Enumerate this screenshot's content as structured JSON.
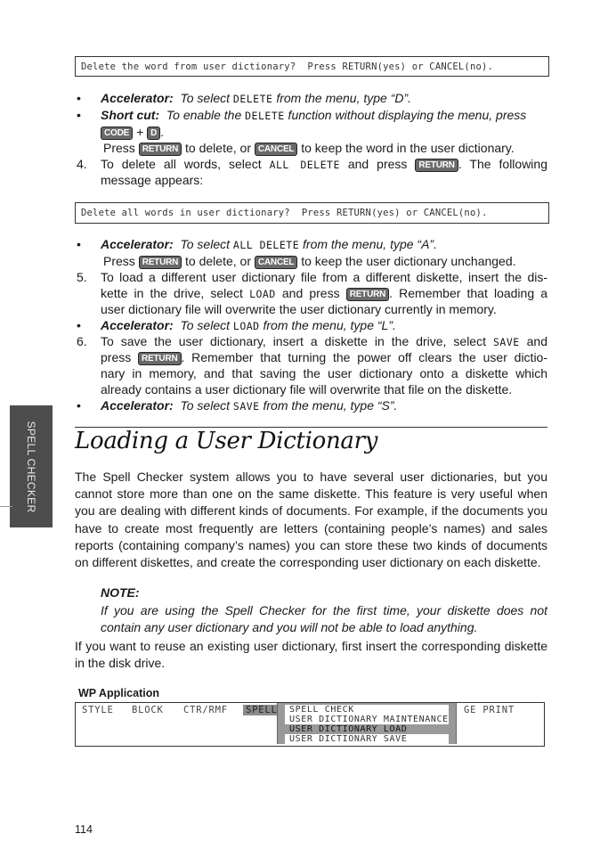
{
  "screen_messages": {
    "delete_word": "Delete the word from user dictionary?  Press RETURN(yes) or CANCEL(no).",
    "delete_all": "Delete all words in user dictionary?  Press RETURN(yes) or CANCEL(no)."
  },
  "keys": {
    "code": "CODE",
    "d": "D",
    "return": "RETURN",
    "cancel": "CANCEL"
  },
  "instructions": {
    "acc_label": "Accelerator:",
    "short_label": "Short cut:",
    "bullet_char": "•",
    "acc_delete": {
      "pre": "To select ",
      "cmd": "DELETE",
      "post": " from the menu, type “D”."
    },
    "shortcut_delete": {
      "pre": "To enable the ",
      "cmd": "DELETE",
      "post": " function without displaying the menu, press"
    },
    "shortcut_plus": " + ",
    "shortcut_end": ".",
    "press_delete_word": {
      "pre": "Press ",
      "mid": " to delete, or ",
      "post": " to keep the word in the user dictionary."
    },
    "step4": {
      "num": "4.",
      "pre": "To delete all words, select ",
      "cmd": "ALL DELETE",
      "mid": " and press ",
      "post": ". The following",
      "line2": "message appears:"
    },
    "acc_all_delete": {
      "pre": "To select ",
      "cmd": "ALL DELETE",
      "post": " from the menu, type “A”."
    },
    "press_delete_all": {
      "pre": "Press ",
      "mid": " to delete, or ",
      "post": " to keep the user dictionary unchanged."
    },
    "step5": {
      "num": "5.",
      "line1": "To load a different user dictionary file from a different diskette, insert the dis-",
      "line2_pre": "kette in the drive, select ",
      "line2_cmd": "LOAD",
      "line2_mid": " and press ",
      "line2_post": ". Remember that loading a",
      "line3": "user dictionary file will overwrite the user dictionary currently in memory."
    },
    "acc_load": {
      "pre": "To select ",
      "cmd": "LOAD",
      "post": " from the menu, type “L”."
    },
    "step6": {
      "num": "6.",
      "line1_pre": "To save the user dictionary, insert a diskette in the drive, select ",
      "line1_cmd": "SAVE",
      "line1_post": " and",
      "line2_pre": "press ",
      "line2_post": ". Remember that turning the power off clears the user dictio-",
      "line3": "nary in memory, and that saving the user dictionary onto a diskette which",
      "line4": "already contains a user dictionary file will overwrite that file on the diskette."
    },
    "acc_save": {
      "pre": "To select ",
      "cmd": "SAVE",
      "post": " from the menu, type “S”."
    }
  },
  "side_tab": {
    "label": "SPELL CHECKER"
  },
  "section": {
    "title": "Loading a User Dictionary",
    "intro": "The Spell Checker system allows you to have several user dictionaries, but you cannot store more than one on the same diskette. This feature is very useful when you are dealing with different kinds of documents. For example, if the documents you have to create most frequently are letters (containing people’s names) and sales reports (containing company’s names) you can store these two kinds of documents on different diskettes, and create the corresponding user dictionary on each diskette.",
    "note_title": "NOTE:",
    "note_body": "If you are using the Spell Checker for the first time, your diskette does not contain any user dictionary and you will not be able to load anything.",
    "reuse": "If you want to reuse an existing user dictionary, first insert the corresponding diskette in the disk drive."
  },
  "wp_screen": {
    "label": "WP Application",
    "menu": [
      "STYLE",
      "BLOCK",
      "CTR/RMF",
      "SPELL",
      "PAGE PRINT"
    ],
    "menu_visible_tail": "GE PRINT",
    "active_menu": "SPELL",
    "dropdown": [
      "SPELL CHECK",
      "USER DICTIONARY MAINTENANCE",
      "USER DICTIONARY LOAD",
      "USER DICTIONARY SAVE"
    ],
    "selected": "USER DICTIONARY LOAD"
  },
  "page_number": "114"
}
